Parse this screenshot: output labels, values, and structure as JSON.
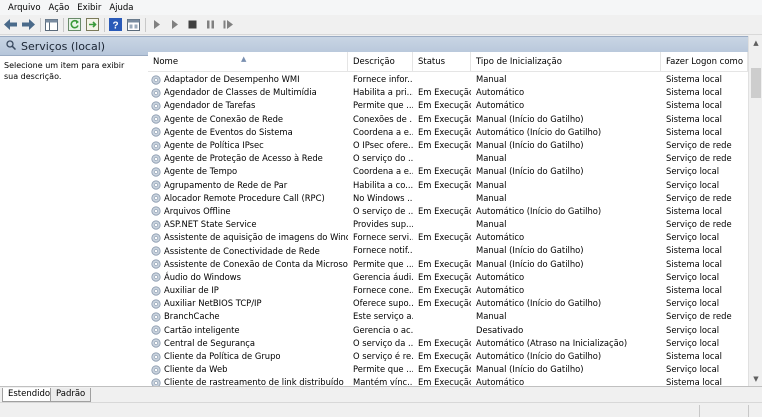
{
  "menu": [
    "Arquivo",
    "Ação",
    "Exibir",
    "Ajuda"
  ],
  "toolbar": {
    "icons": [
      "back-icon",
      "forward-icon",
      "show-hide-tree-icon",
      "refresh-icon",
      "export-list-icon",
      "help-icon",
      "properties-icon",
      "start-icon",
      "start-alt-icon",
      "stop-icon",
      "pause-icon",
      "restart-icon"
    ],
    "colors": {
      "back_forward": "#4a6a8a",
      "refresh": "#3a9a3a",
      "help": "#2a5ab8",
      "media": "#404040"
    }
  },
  "panel": {
    "title": "Serviços (local)"
  },
  "description_pane": {
    "text": "Selecione um item para exibir sua descrição."
  },
  "columns": [
    "Nome",
    "Descrição",
    "Status",
    "Tipo de Inicialização",
    "Fazer Logon como"
  ],
  "services": [
    [
      "Adaptador de Desempenho WMI",
      "Fornece infor...",
      "",
      "Manual",
      "Sistema local"
    ],
    [
      "Agendador de Classes de Multimídia",
      "Habilita a pri...",
      "Em Execução",
      "Automático",
      "Sistema local"
    ],
    [
      "Agendador de Tarefas",
      "Permite que ...",
      "Em Execução",
      "Automático",
      "Sistema local"
    ],
    [
      "Agente de Conexão de Rede",
      "Conexões de ...",
      "Em Execução",
      "Manual (Início do Gatilho)",
      "Sistema local"
    ],
    [
      "Agente de Eventos do Sistema",
      "Coordena a e...",
      "Em Execução",
      "Automático (Início do Gatilho)",
      "Sistema local"
    ],
    [
      "Agente de Política IPsec",
      "O IPsec ofere...",
      "Em Execução",
      "Manual (Início do Gatilho)",
      "Serviço de rede"
    ],
    [
      "Agente de Proteção de Acesso à Rede",
      "O serviço do ...",
      "",
      "Manual",
      "Serviço de rede"
    ],
    [
      "Agente de Tempo",
      "Coordena a e...",
      "Em Execução",
      "Manual (Início do Gatilho)",
      "Serviço local"
    ],
    [
      "Agrupamento de Rede de Par",
      "Habilita a co...",
      "Em Execução",
      "Manual",
      "Serviço local"
    ],
    [
      "Alocador Remote Procedure Call (RPC)",
      "No Windows ...",
      "",
      "Manual",
      "Serviço de rede"
    ],
    [
      "Arquivos Offline",
      "O serviço de ...",
      "Em Execução",
      "Automático (Início do Gatilho)",
      "Sistema local"
    ],
    [
      "ASP.NET State Service",
      "Provides sup...",
      "",
      "Manual",
      "Serviço de rede"
    ],
    [
      "Assistente de aquisição de imagens do Window...",
      "Fornece servi...",
      "Em Execução",
      "Automático",
      "Serviço local"
    ],
    [
      "Assistente de Conectividade de Rede",
      "Fornece notif...",
      "",
      "Manual (Início do Gatilho)",
      "Sistema local"
    ],
    [
      "Assistente de Conexão de Conta da Microsoft",
      "Permite que ...",
      "Em Execução",
      "Manual (Início do Gatilho)",
      "Sistema local"
    ],
    [
      "Áudio do Windows",
      "Gerencia áudi...",
      "Em Execução",
      "Automático",
      "Serviço local"
    ],
    [
      "Auxiliar de IP",
      "Fornece cone...",
      "Em Execução",
      "Automático",
      "Sistema local"
    ],
    [
      "Auxiliar NetBIOS TCP/IP",
      "Oferece supo...",
      "Em Execução",
      "Automático (Início do Gatilho)",
      "Serviço local"
    ],
    [
      "BranchCache",
      "Este serviço a...",
      "",
      "Manual",
      "Serviço de rede"
    ],
    [
      "Cartão inteligente",
      "Gerencia o ac...",
      "",
      "Desativado",
      "Serviço local"
    ],
    [
      "Central de Segurança",
      "O serviço da ...",
      "Em Execução",
      "Automático (Atraso na Inicialização)",
      "Serviço local"
    ],
    [
      "Cliente da Política de Grupo",
      "O serviço é re...",
      "Em Execução",
      "Automático (Início do Gatilho)",
      "Sistema local"
    ],
    [
      "Cliente da Web",
      "Permite que ...",
      "Em Execução",
      "Manual (Início do Gatilho)",
      "Serviço local"
    ],
    [
      "Cliente de rastreamento de link distribuído",
      "Mantém vínc...",
      "Em Execução",
      "Automático",
      "Sistema local"
    ]
  ],
  "tabs": [
    "Estendido",
    "Padrão"
  ]
}
